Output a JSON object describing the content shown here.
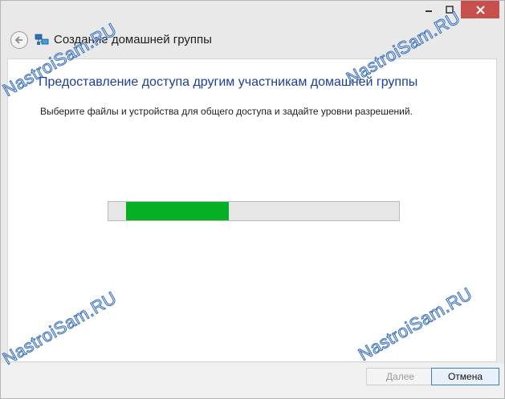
{
  "window": {
    "title": "Создание домашней группы",
    "controls": {
      "minimize": "minimize",
      "maximize": "maximize",
      "close": "close"
    }
  },
  "content": {
    "heading": "Предоставление доступа другим участникам домашней группы",
    "instruction": "Выберите файлы и устройства для общего доступа и задайте уровни разрешений."
  },
  "progress": {
    "indeterminate": true,
    "color": "#06b025"
  },
  "footer": {
    "next_label": "Далее",
    "cancel_label": "Отмена"
  },
  "watermark": "NastroiSam.RU"
}
